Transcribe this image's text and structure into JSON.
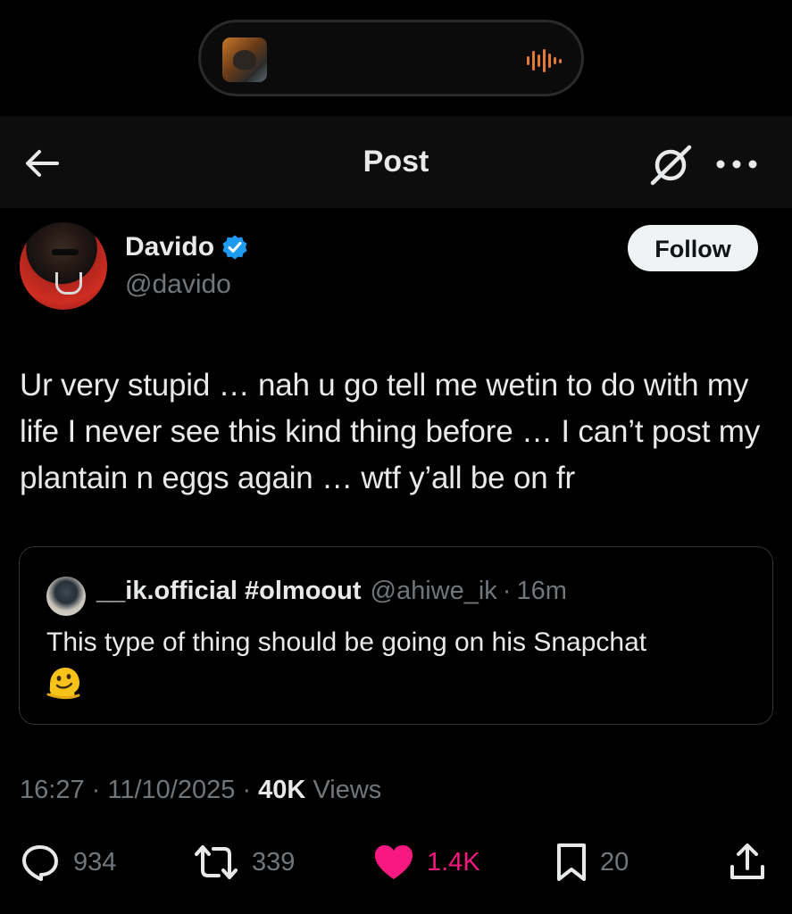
{
  "header": {
    "title": "Post"
  },
  "author": {
    "name": "Davido",
    "handle": "@davido",
    "follow_label": "Follow"
  },
  "post": {
    "text": "Ur very stupid … nah u go tell me wetin to do with my life I never see this kind thing before … I can’t post my plantain n eggs again … wtf y’all be on fr"
  },
  "quote": {
    "name": "__ik.official #olmoout",
    "handle": "@ahiwe_ik",
    "separator": "·",
    "time": "16m",
    "text": "This type of thing should be going on his Snapchat",
    "emoji": "melting-face-emoji"
  },
  "meta": {
    "time": "16:27",
    "date": "11/10/2025",
    "separator": "·",
    "views_count": "40K",
    "views_label": "Views"
  },
  "actions": {
    "replies": "934",
    "reposts": "339",
    "likes": "1.4K",
    "bookmarks": "20"
  },
  "colors": {
    "background": "#000000",
    "text_primary": "#e7e9ea",
    "text_secondary": "#71767b",
    "like_pink": "#f91880",
    "verified_blue": "#1d9bf0",
    "media_orange": "#e07a38"
  },
  "icons": [
    "media-art-icon",
    "audio-wave-icon",
    "back-arrow-icon",
    "grok-icon",
    "more-icon",
    "verified-badge-icon",
    "reply-icon",
    "repost-icon",
    "like-icon",
    "bookmark-icon",
    "share-icon"
  ]
}
